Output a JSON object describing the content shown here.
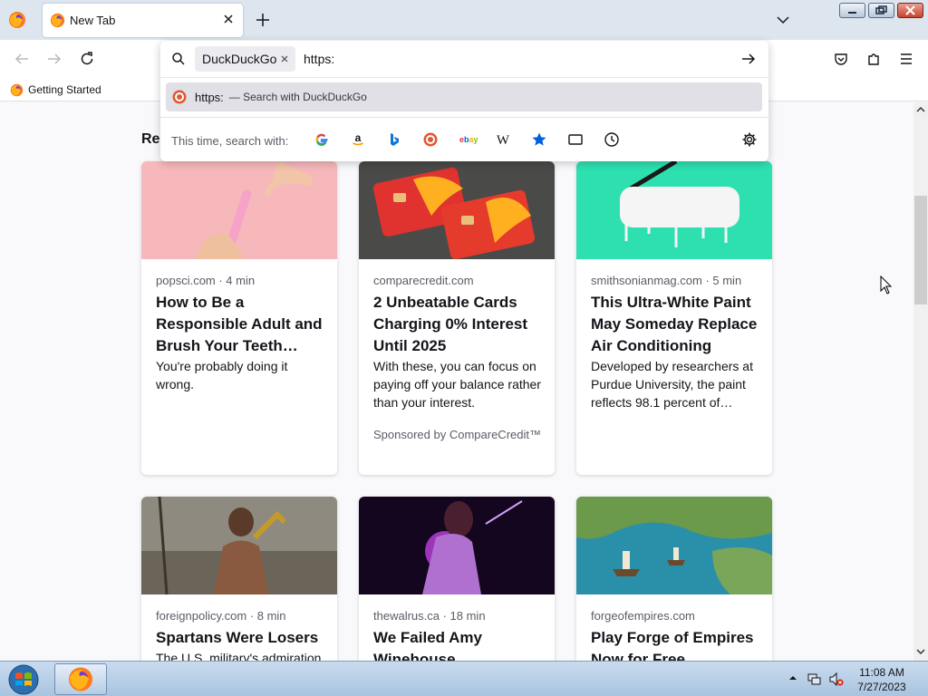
{
  "tabs": {
    "active": {
      "title": "New Tab",
      "favicon": "firefox-icon"
    }
  },
  "bookmarks": [
    {
      "label": "Getting Started",
      "icon": "firefox-icon"
    }
  ],
  "urlbar": {
    "search_mode_chip": "DuckDuckGo",
    "input_value": "https:",
    "suggestion": {
      "text": "https:",
      "action": "— Search with DuckDuckGo",
      "icon": "duckduckgo-icon"
    },
    "oneoff_label": "This time, search with:",
    "oneoff_engines": [
      "google-icon",
      "amazon-icon",
      "bing-icon",
      "duckduckgo-icon",
      "ebay-icon",
      "wikipedia-icon",
      "bookmarks-star-icon",
      "tabs-icon",
      "history-icon"
    ],
    "settings_icon": "gear-icon"
  },
  "section": {
    "title": "Re"
  },
  "cards": [
    {
      "source": "popsci.com · 4 min",
      "headline": "How to Be a Responsible Adult and Brush Your Teeth…",
      "excerpt": "You're probably doing it wrong.",
      "sponsor": ""
    },
    {
      "source": "comparecredit.com",
      "headline": "2 Unbeatable Cards Charging 0% Interest Until 2025",
      "excerpt": "With these, you can focus on paying off your balance rather than your interest.",
      "sponsor": "Sponsored by CompareCredit™"
    },
    {
      "source": "smithsonianmag.com · 5 min",
      "headline": "This Ultra-White Paint May Someday Replace Air Conditioning",
      "excerpt": "Developed by researchers at Purdue University, the paint reflects 98.1 percent of…",
      "sponsor": ""
    },
    {
      "source": "foreignpolicy.com · 8 min",
      "headline": "Spartans Were Losers",
      "excerpt": "The U.S. military's admiration",
      "sponsor": ""
    },
    {
      "source": "thewalrus.ca · 18 min",
      "headline": "We Failed Amy Winehouse",
      "excerpt": "",
      "sponsor": ""
    },
    {
      "source": "forgeofempires.com",
      "headline": "Play Forge of Empires Now for Free",
      "excerpt": "",
      "sponsor": ""
    }
  ],
  "taskbar": {
    "clock_time": "11:08 AM",
    "clock_date": "7/27/2023"
  },
  "colors": {
    "accent": "#0060df",
    "tab_strip": "#dde6ef",
    "taskbar": "#b9cfe6"
  }
}
